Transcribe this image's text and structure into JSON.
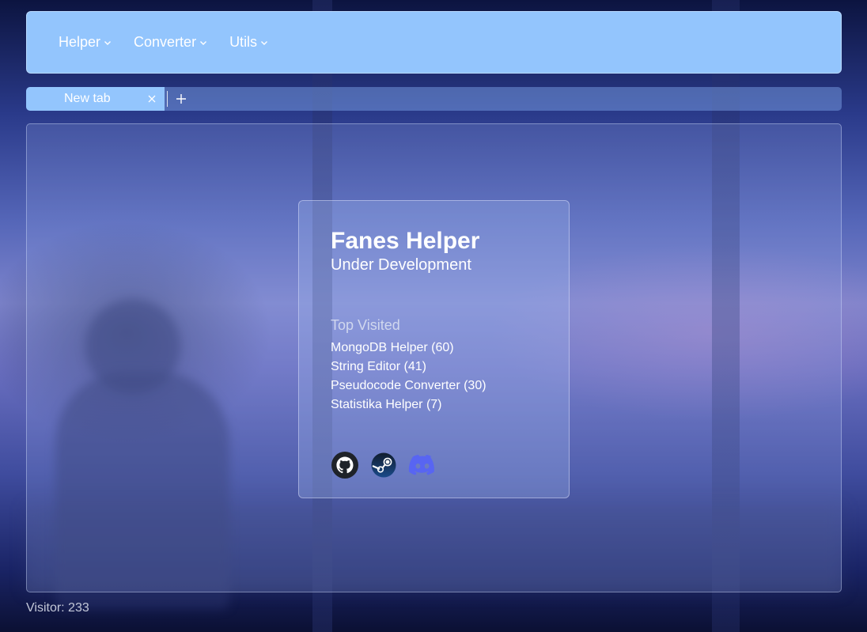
{
  "navbar": {
    "items": [
      {
        "label": "Helper"
      },
      {
        "label": "Converter"
      },
      {
        "label": "Utils"
      }
    ]
  },
  "tabs": {
    "items": [
      {
        "label": "New tab"
      }
    ]
  },
  "card": {
    "title": "Fanes Helper",
    "subtitle": "Under Development",
    "top_visited_label": "Top Visited",
    "top_visited": [
      "MongoDB Helper (60)",
      "String Editor (41)",
      "Pseudocode Converter (30)",
      "Statistika Helper (7)"
    ],
    "socials": [
      "github-icon",
      "steam-icon",
      "discord-icon"
    ]
  },
  "footer": {
    "visitor_text": "Visitor: 233"
  },
  "colors": {
    "navbar_bg": "#93c5fd",
    "discord": "#5865f2"
  }
}
